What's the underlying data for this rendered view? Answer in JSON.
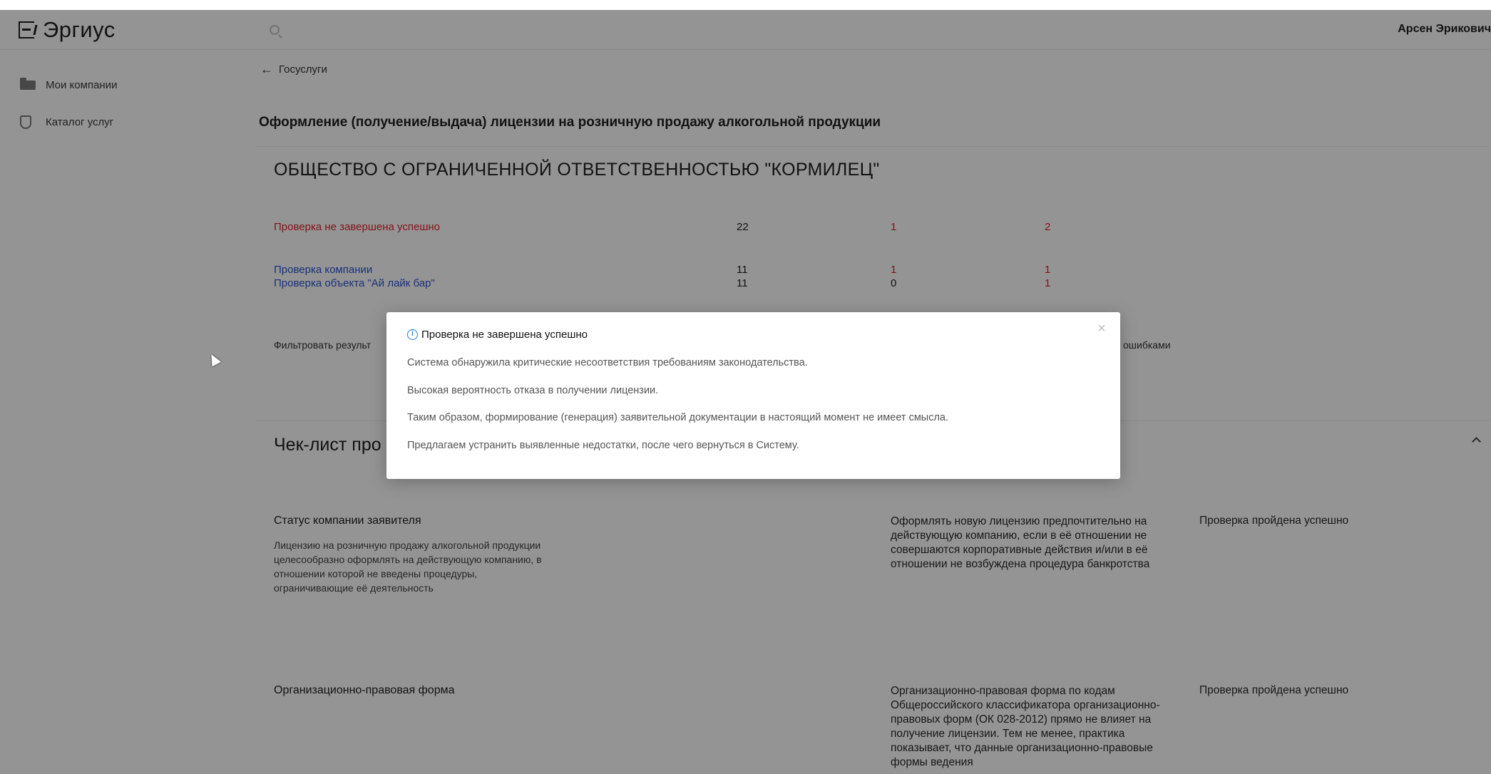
{
  "header": {
    "logo": "Эргиус",
    "search_placeholder": "",
    "user_name": "Арсен Эрикович"
  },
  "sidebar": {
    "items": [
      {
        "label": "Мои компании",
        "icon": "folder-icon"
      },
      {
        "label": "Каталог услуг",
        "icon": "shield-icon"
      }
    ]
  },
  "main": {
    "back_label": "Госуслуги",
    "page_title": "Оформление (получение/выдача) лицензии на розничную продажу алкогольной продукции",
    "company_name": "ОБЩЕСТВО С ОГРАНИЧЕННОЙ ОТВЕТСТВЕННОСТЬЮ \"КОРМИЛЕЦ\"",
    "summary": {
      "headers": [
        "",
        "",
        "",
        ""
      ],
      "overall": {
        "result": "Проверка не завершена успешно",
        "checks": "22",
        "remarks": "1",
        "errors": "2"
      },
      "rows": [
        {
          "label": "Проверка компании",
          "checks": "11",
          "remarks": "1",
          "errors": "1"
        },
        {
          "label": "Проверка объекта \"Ай лайк бар\"",
          "checks": "11",
          "remarks": "0",
          "errors": "1"
        }
      ]
    },
    "filter_label": "Фильтровать результ",
    "filter_right": "ошибками",
    "checklist_title": "Чек-лист про",
    "checklist": [
      {
        "col_headers": [
          "",
          "",
          "",
          ""
        ],
        "question": "Статус компании заявителя",
        "description": "Лицензию на розничную продажу алкогольной продукции целесообразно оформлять на действующую компанию, в отношении которой не введены процедуры, ограничивающие её деятельность",
        "answer": "",
        "answer_note": "",
        "rationale": "Оформлять новую лицензию предпочтительно на действующую компанию, если в её отношении не совершаются корпоративные действия и/или в её отношении не возбуждена процедура банкротства",
        "result": "Проверка пройдена успешно"
      },
      {
        "col_headers": [
          "",
          "",
          "",
          ""
        ],
        "question": "Организационно-правовая форма",
        "description": "",
        "answer": "",
        "answer_note": "",
        "rationale": "Организационно-правовая форма по кодам Общероссийского классификатора организационно-правовых форм (ОК 028-2012) прямо не влияет на получение лицензии. Тем не менее, практика показывает, что данные организационно-правовые формы ведения",
        "result": "Проверка пройдена успешно"
      }
    ]
  },
  "modal": {
    "title": "Проверка не завершена успешно",
    "lines": [
      "Система обнаружила критические несоответствия требованиям законодательства.",
      "Высокая вероятность отказа в получении лицензии.",
      "Таким образом, формирование (генерация) заявительной документации в настоящий момент не имеет смысла.",
      "Предлагаем устранить выявленные недостатки, после чего вернуться в Систему."
    ],
    "close_icon": "close-icon",
    "info_icon": "info-icon"
  },
  "colors": {
    "error_red": "#e0242f",
    "link_blue": "#2a55d4",
    "answer_green": "#3fae7a",
    "info_blue": "#2a7bd8"
  }
}
